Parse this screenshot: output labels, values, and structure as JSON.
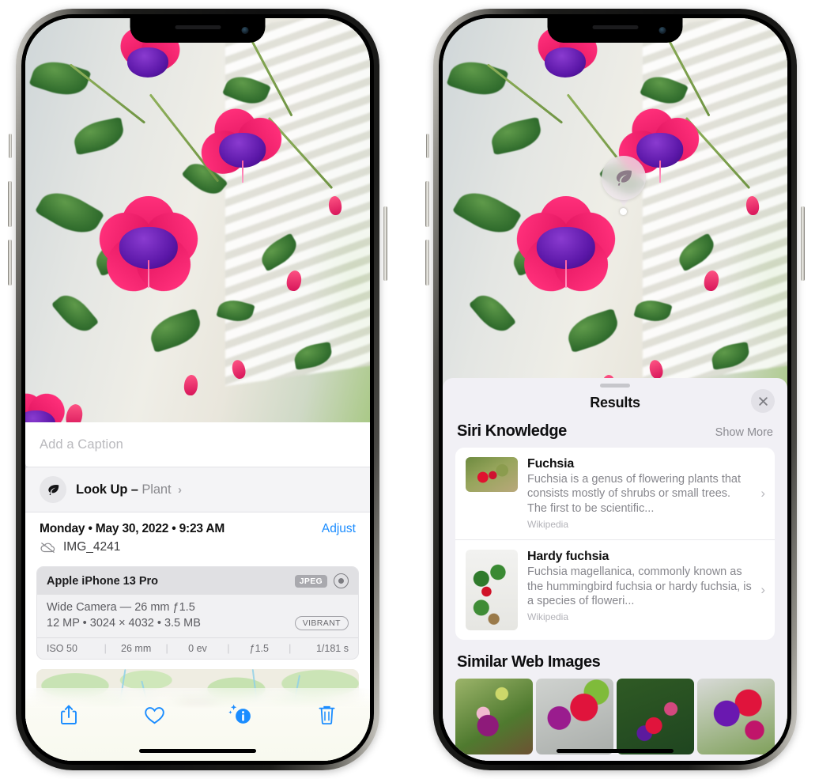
{
  "left_phone": {
    "photo": {
      "alt_name": "fuchsia-plant-photo"
    },
    "caption_placeholder": "Add a Caption",
    "lookup": {
      "icon": "leaf-icon",
      "sparkle_icon": "sparkles-icon",
      "label": "Look Up –",
      "subject": "Plant",
      "chevron": "›"
    },
    "meta": {
      "date": "Monday • May 30, 2022 • 9:23 AM",
      "adjust_label": "Adjust",
      "cloud_icon": "icloud-slash-icon",
      "filename": "IMG_4241"
    },
    "camera_card": {
      "device": "Apple iPhone 13 Pro",
      "format_badge": "JPEG",
      "raw_icon": "aperture-icon",
      "lens_line": "Wide Camera — 26 mm ƒ1.5",
      "size_line": "12 MP • 3024 × 4032 • 3.5 MB",
      "style_badge": "VIBRANT",
      "exif": [
        "ISO 50",
        "26 mm",
        "0 ev",
        "ƒ1.5",
        "1/181 s"
      ]
    },
    "toolbar": [
      {
        "name": "share-icon",
        "label": "Share"
      },
      {
        "name": "heart-icon",
        "label": "Favorite"
      },
      {
        "name": "info-sparkle-icon",
        "label": "Info"
      },
      {
        "name": "trash-icon",
        "label": "Delete"
      }
    ]
  },
  "right_phone": {
    "badge": {
      "icon": "leaf-icon",
      "name": "visual-lookup-badge"
    },
    "sheet": {
      "title": "Results",
      "close_icon": "close-icon",
      "sections": [
        {
          "title": "Siri Knowledge",
          "action": "Show More",
          "items": [
            {
              "name": "Fuchsia",
              "description": "Fuchsia is a genus of flowering plants that consists mostly of shrubs or small trees. The first to be scientific...",
              "source": "Wikipedia",
              "chevron": "›"
            },
            {
              "name": "Hardy fuchsia",
              "description": "Fuchsia magellanica, commonly known as the hummingbird fuchsia or hardy fuchsia, is a species of floweri...",
              "source": "Wikipedia",
              "chevron": "›"
            }
          ]
        },
        {
          "title": "Similar Web Images",
          "thumbs": [
            "web-image-1",
            "web-image-2",
            "web-image-3",
            "web-image-4"
          ]
        }
      ]
    }
  },
  "colors": {
    "accent_blue": "#1a8cff",
    "sheet_bg": "#f1f0f5",
    "card_bg": "#ffffff",
    "secondary_text": "#87878d"
  }
}
